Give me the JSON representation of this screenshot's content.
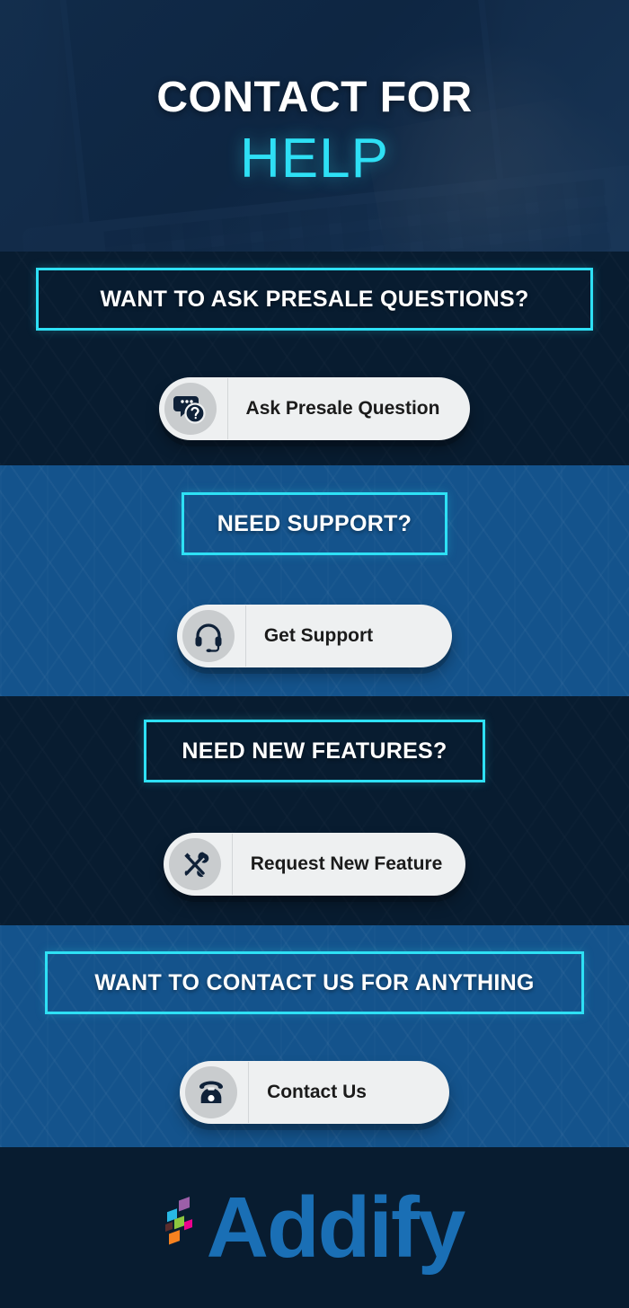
{
  "hero": {
    "title_line1": "CONTACT FOR",
    "title_line2": "HELP",
    "accent_color": "#2ee0f5",
    "background_image": "laptop-typing-photo"
  },
  "sections": [
    {
      "id": "presale",
      "theme": "dark",
      "background_color": "#081c30",
      "banner_text": "WANT TO ASK PRESALE QUESTIONS?",
      "banner_border_color": "#2ee0f5",
      "button_label": "Ask Presale Question",
      "button_icon": "speech-bubbles-question-icon"
    },
    {
      "id": "support",
      "theme": "blue",
      "background_color": "#14538c",
      "banner_text": "NEED SUPPORT?",
      "banner_border_color": "#2ee0f5",
      "button_label": "Get Support",
      "button_icon": "headset-icon"
    },
    {
      "id": "features",
      "theme": "dark",
      "background_color": "#081c30",
      "banner_text": "NEED NEW FEATURES?",
      "banner_border_color": "#2ee0f5",
      "button_label": "Request New Feature",
      "button_icon": "wrench-screwdriver-icon"
    },
    {
      "id": "contact",
      "theme": "blue",
      "background_color": "#14538c",
      "banner_text": "WANT TO CONTACT US FOR ANYTHING",
      "banner_border_color": "#2ee0f5",
      "button_label": "Contact Us",
      "button_icon": "telephone-icon"
    }
  ],
  "footer": {
    "logo_text": "Addify",
    "logo_color": "#1a6fb5",
    "logo_mark_colors": [
      "#29b8e5",
      "#9c5fa8",
      "#8dc63f",
      "#5a2d2d",
      "#ec008c",
      "#f58220"
    ],
    "background_color": "#081c30"
  }
}
